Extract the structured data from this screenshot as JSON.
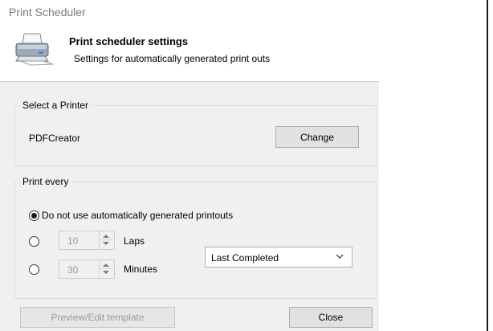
{
  "window": {
    "title": "Print Scheduler"
  },
  "header": {
    "icon": "printer-icon",
    "title": "Print scheduler settings",
    "subtitle": "Settings for automatically generated print outs"
  },
  "printer_group": {
    "label": "Select a Printer",
    "printer_name": "PDFCreator",
    "change_label": "Change"
  },
  "print_every_group": {
    "label": "Print every",
    "options": [
      {
        "label": "Do not use automatically generated printouts",
        "checked": true
      },
      {
        "label": "Laps",
        "value": "10",
        "checked": false
      },
      {
        "label": "Minutes",
        "value": "30",
        "checked": false
      }
    ],
    "mode_select": {
      "value": "Last Completed"
    }
  },
  "footer": {
    "preview_label": "Preview/Edit template",
    "close_label": "Close"
  }
}
